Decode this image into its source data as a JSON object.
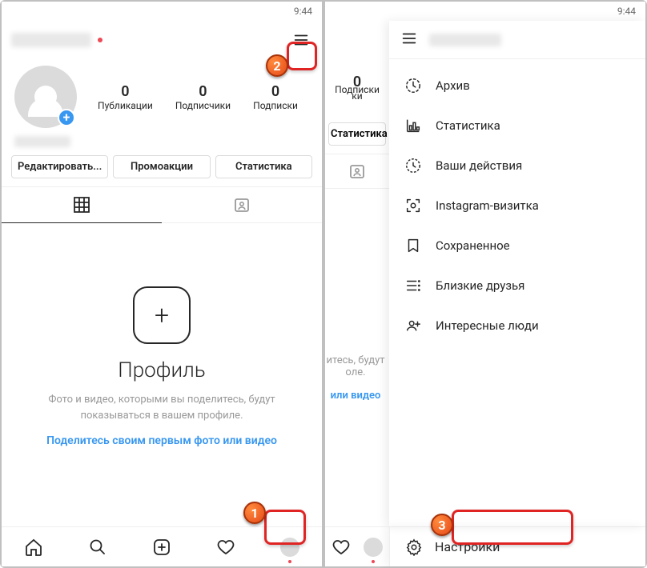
{
  "status_bar": {
    "time": "9:44"
  },
  "left": {
    "stats": [
      {
        "value": "0",
        "label": "Публикации"
      },
      {
        "value": "0",
        "label": "Подписчики"
      },
      {
        "value": "0",
        "label": "Подписки"
      }
    ],
    "buttons": {
      "edit": "Редактировать...",
      "promo": "Промоакции",
      "stats": "Статистика"
    },
    "empty": {
      "title": "Профиль",
      "desc": "Фото и видео, которыми вы поделитесь, будут показываться в вашем профиле.",
      "link": "Поделитесь своим первым фото или видео"
    }
  },
  "right": {
    "frag": {
      "stat1_label": "ки",
      "stat2_label": "Подписки",
      "btn": "Статистика",
      "desc_l1": "итесь, будут",
      "desc_l2": "оле.",
      "link": "или видео"
    },
    "menu": [
      {
        "icon": "archive",
        "label": "Архив"
      },
      {
        "icon": "insights",
        "label": "Статистика"
      },
      {
        "icon": "activity",
        "label": "Ваши действия"
      },
      {
        "icon": "nametag",
        "label": "Instagram-визитка"
      },
      {
        "icon": "saved",
        "label": "Сохраненное"
      },
      {
        "icon": "close-friends",
        "label": "Близкие друзья"
      },
      {
        "icon": "discover",
        "label": "Интересные люди"
      }
    ],
    "settings_label": "Настройки"
  },
  "callouts": {
    "one": "1",
    "two": "2",
    "three": "3"
  }
}
